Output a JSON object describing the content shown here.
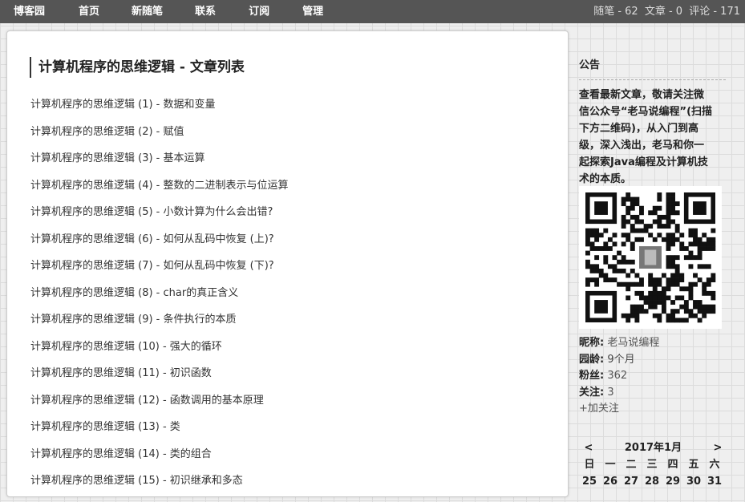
{
  "topnav": {
    "items": [
      "博客园",
      "首页",
      "新随笔",
      "联系",
      "订阅",
      "管理"
    ]
  },
  "stats": {
    "posts": "随笔 - 62",
    "articles": "文章 - 0",
    "comments": "评论 - 171"
  },
  "main": {
    "title": "计算机程序的思维逻辑 - 文章列表",
    "posts": [
      "计算机程序的思维逻辑 (1) - 数据和变量",
      "计算机程序的思维逻辑 (2) - 赋值",
      "计算机程序的思维逻辑 (3) - 基本运算",
      "计算机程序的思维逻辑 (4) - 整数的二进制表示与位运算",
      "计算机程序的思维逻辑 (5) - 小数计算为什么会出错?",
      "计算机程序的思维逻辑 (6) - 如何从乱码中恢复 (上)?",
      "计算机程序的思维逻辑 (7) - 如何从乱码中恢复 (下)?",
      "计算机程序的思维逻辑 (8) - char的真正含义",
      "计算机程序的思维逻辑 (9) - 条件执行的本质",
      "计算机程序的思维逻辑 (10) - 强大的循环",
      "计算机程序的思维逻辑 (11) - 初识函数",
      "计算机程序的思维逻辑 (12) - 函数调用的基本原理",
      "计算机程序的思维逻辑 (13) - 类",
      "计算机程序的思维逻辑 (14) - 类的组合",
      "计算机程序的思维逻辑 (15) - 初识继承和多态"
    ]
  },
  "sidebar": {
    "notice_title": "公告",
    "notice_lines": [
      "查看最新文章，敬请关注微",
      "信公众号“老马说编程”(扫描",
      "下方二维码)，从入门到高",
      "级，深入浅出，老马和你一",
      "起探索Java编程及计算机技",
      "术的本质。"
    ],
    "qr_icon": "qr-code",
    "profile": {
      "nickname_label": "昵称:",
      "nickname": "老马说编程",
      "age_label": "园龄:",
      "age": "9个月",
      "fans_label": "粉丝:",
      "fans": "362",
      "follow_label": "关注:",
      "follow": "3",
      "add_follow": "+加关注"
    }
  },
  "calendar": {
    "prev": "<",
    "month": "2017年1月",
    "next": ">",
    "weekdays": [
      "日",
      "一",
      "二",
      "三",
      "四",
      "五",
      "六"
    ],
    "first_row": [
      "25",
      "26",
      "27",
      "28",
      "29",
      "30",
      "31"
    ]
  }
}
